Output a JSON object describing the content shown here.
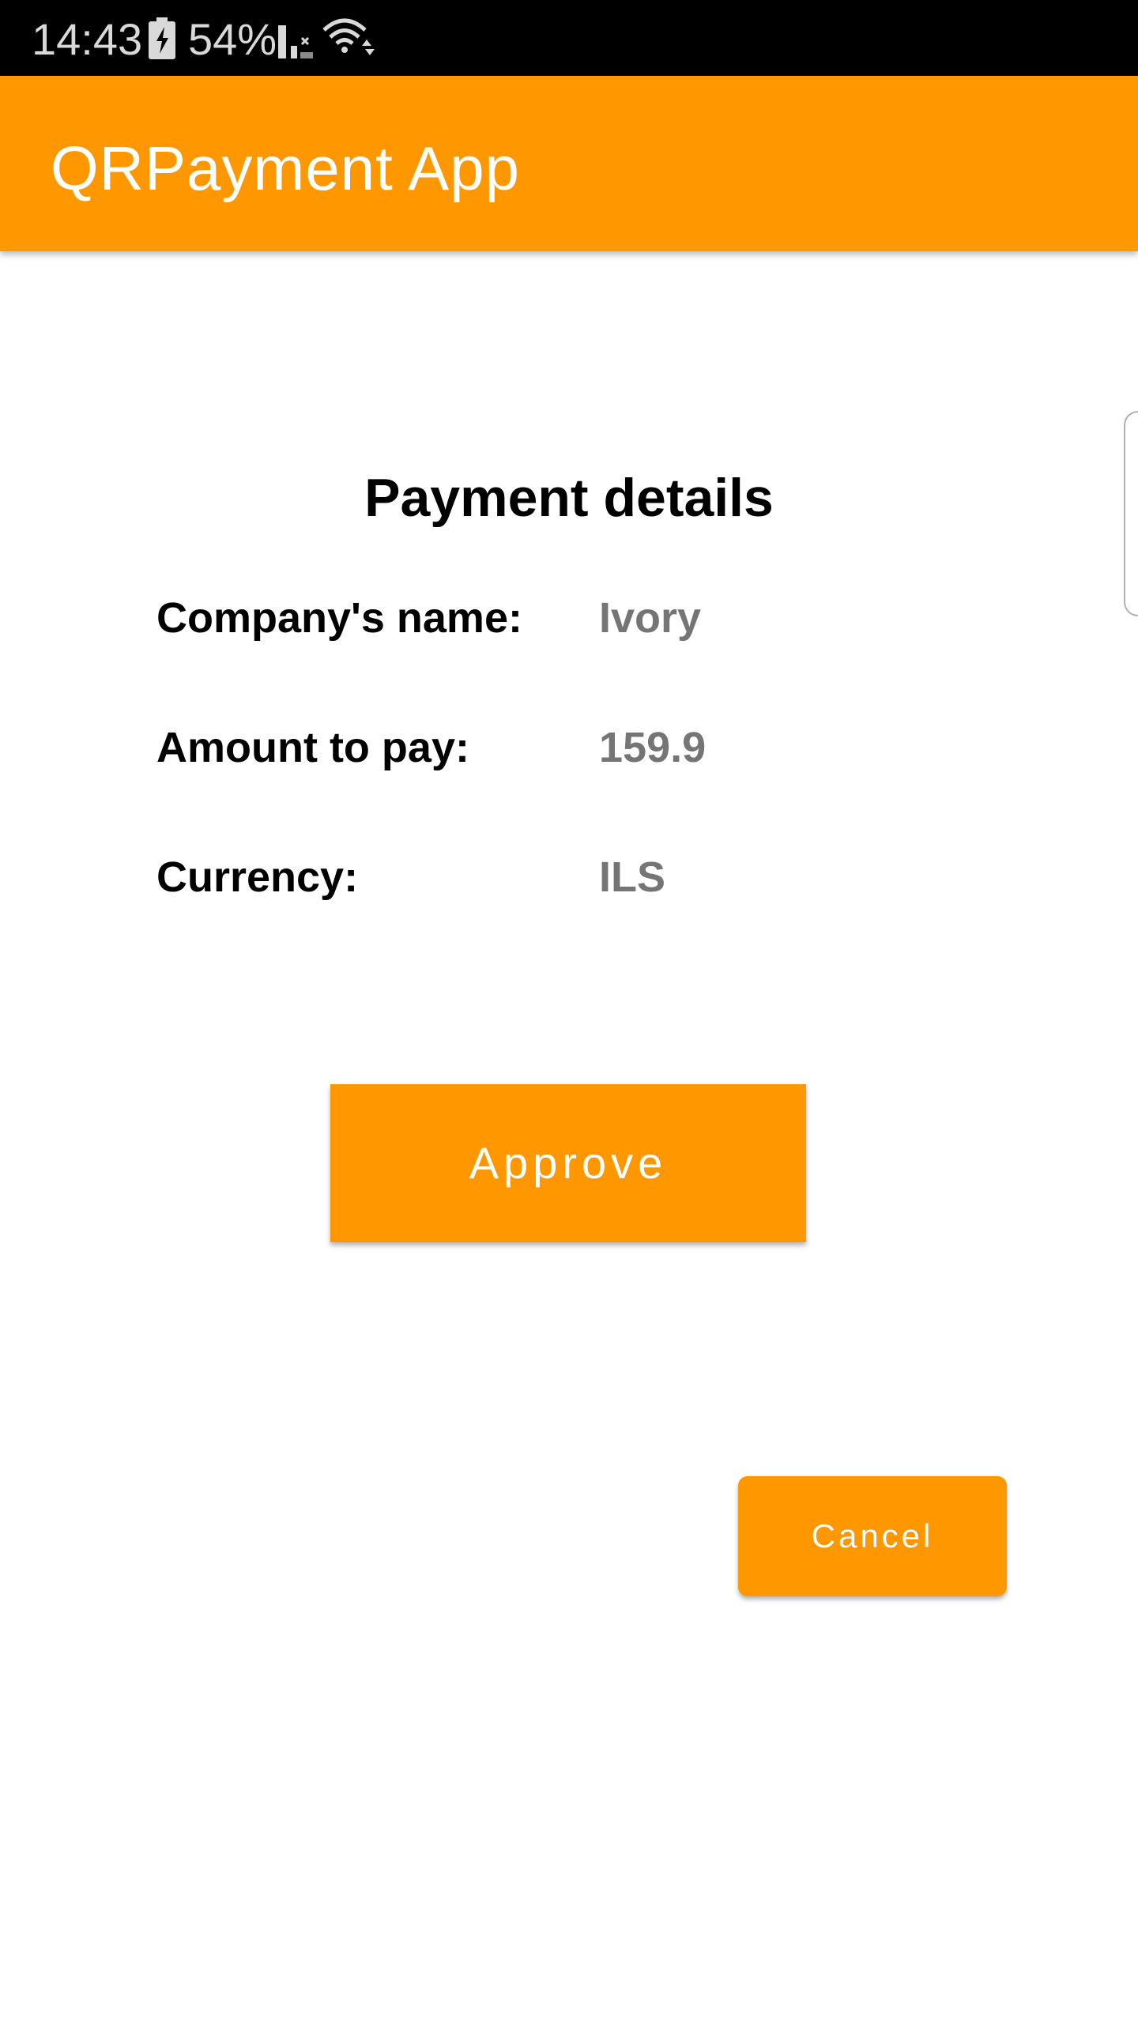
{
  "status_bar": {
    "time": "14:43",
    "battery_percent": "54%",
    "icons": [
      "battery-charging-icon",
      "cell-signal-icon",
      "wifi-icon"
    ]
  },
  "app_bar": {
    "title": "QRPayment App",
    "color": "#ff9800"
  },
  "payment_details": {
    "heading": "Payment details",
    "rows": [
      {
        "label": "Company's name:",
        "value": "Ivory"
      },
      {
        "label": "Amount to pay:",
        "value": "159.9"
      },
      {
        "label": "Currency:",
        "value": "ILS"
      }
    ]
  },
  "actions": {
    "approve_label": "Approve",
    "cancel_label": "Cancel"
  },
  "colors": {
    "accent": "#ff9800",
    "value_text": "#757575",
    "label_text": "#000000"
  }
}
